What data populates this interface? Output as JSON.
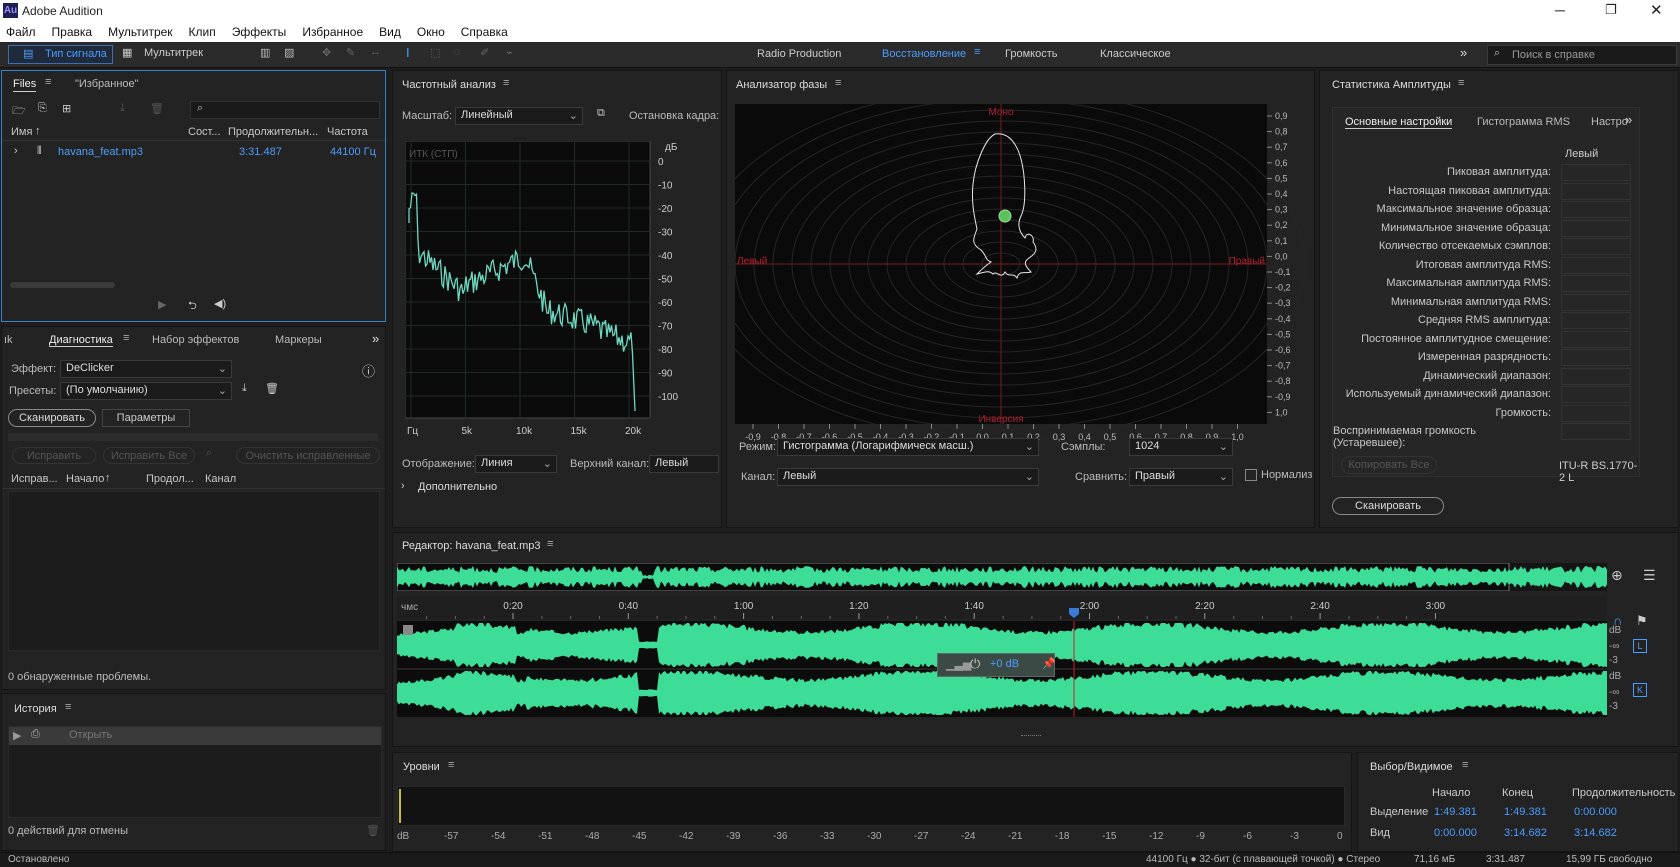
{
  "app": {
    "title": "Adobe Audition",
    "logo": "Au"
  },
  "menu": [
    "Файл",
    "Правка",
    "Мультитрек",
    "Клип",
    "Эффекты",
    "Избранное",
    "Вид",
    "Окно",
    "Справка"
  ],
  "toolbar": {
    "waveform_tab": "Тип сигнала",
    "multitrack_tab": "Мультитрек",
    "workspaces": [
      "Radio Production",
      "Восстановление",
      "Громкость",
      "Классическое"
    ],
    "active_workspace": "Восстановление",
    "search_placeholder": "Поиск в справке"
  },
  "files": {
    "tab_files": "Files",
    "tab_favorites": "\"Избранное\"",
    "columns": [
      "Имя",
      "Сост...",
      "Продолжительн...",
      "Частота"
    ],
    "rows": [
      {
        "name": "havana_feat.mp3",
        "duration": "3:31.487",
        "rate": "44100 Гц"
      }
    ]
  },
  "diagnostics": {
    "tab_cut": "ık",
    "tabs": [
      "Диагностика",
      "Набор эффектов",
      "Маркеры"
    ],
    "effect_label": "Эффект:",
    "effect_value": "DeClicker",
    "preset_label": "Пресеты:",
    "preset_value": "(По умолчанию)",
    "scan_button": "Сканировать",
    "params_button": "Параметры",
    "fix_button": "Исправить",
    "fix_all_button": "Исправить Все",
    "clear_button": "Очистить исправленные",
    "columns": [
      "Исправ...",
      "Начало",
      "Продол...",
      "Канал"
    ],
    "status": "0 обнаруженные проблемы."
  },
  "history": {
    "title": "История",
    "items": [
      "Открыть"
    ],
    "status": "0 действий для отмены"
  },
  "freq": {
    "title": "Частотный анализ",
    "scale_label": "Масштаб:",
    "scale_value": "Линейный",
    "freeze_label": "Остановка кадра:",
    "overlay": "ИТК (СТП)",
    "db_label": "дБ",
    "y_ticks": [
      "0",
      "-10",
      "-20",
      "-30",
      "-40",
      "-50",
      "-60",
      "-70",
      "-80",
      "-90",
      "-100"
    ],
    "x_ticks": [
      "Гц",
      "5k",
      "10k",
      "15k",
      "20k"
    ],
    "display_label": "Отображение:",
    "display_value": "Линия",
    "top_channel_label": "Верхний канал:",
    "top_channel_value": "Левый",
    "advanced": "Дополнительно"
  },
  "phase": {
    "title": "Анализатор фазы",
    "labels": {
      "top": "Моно",
      "bottom": "Инверсия",
      "left": "Левый",
      "right": "Правый"
    },
    "x_ticks": [
      "-0,9",
      "-0,8",
      "-0,7",
      "-0,6",
      "-0,5",
      "-0,4",
      "-0,3",
      "-0,2",
      "-0,1",
      "0,0",
      "0,1",
      "0,2",
      "0,3",
      "0,4",
      "0,5",
      "0,6",
      "0,7",
      "0,8",
      "0,9",
      "1,0"
    ],
    "y_ticks": [
      "0,9",
      "0,8",
      "0,7",
      "0,6",
      "0,5",
      "0,4",
      "0,3",
      "0,2",
      "0,1",
      "0,0",
      "-0,1",
      "-0,2",
      "-0,3",
      "-0,4",
      "-0,5",
      "-0,6",
      "-0,7",
      "-0,8",
      "-0,9",
      "1,0"
    ],
    "mode_label": "Режим:",
    "mode_value": "Гистограмма (Логарифмическ масш.)",
    "samples_label": "Сэмплы:",
    "samples_value": "1024",
    "channel_label": "Канал:",
    "channel_value": "Левый",
    "compare_label": "Сравнить:",
    "compare_value": "Правый",
    "normalize_label": "Нормализ"
  },
  "amplitude": {
    "title": "Статистика Амплитуды",
    "tabs": [
      "Основные настройки",
      "Гистограмма RMS",
      "Настро"
    ],
    "column": "Левый",
    "rows": [
      "Пиковая амплитуда:",
      "Настоящая пиковая амплитуда:",
      "Максимальное значение образца:",
      "Минимальное значение образца:",
      "Количество отсекаемых сэмплов:",
      "Итоговая амплитуда RMS:",
      "Максимальная амплитуда RMS:",
      "Минимальная амплитуда RMS:",
      "Средняя RMS амплитуда:",
      "Постоянное амплитудное смещение:",
      "Измеренная разрядность:",
      "Динамический диапазон:",
      "Используемый динамический диапазон:",
      "Громкость:",
      "Воспринимаемая громкость (Устаревшее):"
    ],
    "copy_button": "Копировать Все",
    "standard": "ITU-R BS.1770-2 L",
    "scan_button": "Сканировать"
  },
  "editor": {
    "title": "Редактор: havana_feat.mp3",
    "ruler_unit": "чмс",
    "ruler_ticks": [
      "0:20",
      "0:40",
      "1:00",
      "1:20",
      "1:40",
      "2:00",
      "2:20",
      "2:40",
      "3:00"
    ],
    "hud_gain": "+0 dB",
    "db_labels": [
      "dB",
      "-∞",
      "-3",
      "dB",
      "-∞",
      "-3"
    ],
    "channel_left": "L",
    "channel_right": "K"
  },
  "levels": {
    "title": "Уровни",
    "ticks": [
      "dB",
      "-57",
      "-54",
      "-51",
      "-48",
      "-45",
      "-42",
      "-39",
      "-36",
      "-33",
      "-30",
      "-27",
      "-24",
      "-21",
      "-18",
      "-15",
      "-12",
      "-9",
      "-6",
      "-3",
      "0"
    ]
  },
  "selection": {
    "title": "Выбор/Видимое",
    "columns": [
      "Начало",
      "Конец",
      "Продолжительность"
    ],
    "sel_label": "Выделение",
    "sel": [
      "1:49.381",
      "1:49.381",
      "0:00.000"
    ],
    "view_label": "Вид",
    "view": [
      "0:00.000",
      "3:14.682",
      "3:14.682"
    ]
  },
  "status": {
    "left": "Остановлено",
    "format": "44100 Гц ● 32-бит (с плавающей точкой) ● Стерео",
    "size": "71,16 мБ",
    "duration": "3:31.487",
    "free": "15,99 ГБ свободно"
  },
  "colors": {
    "wave": "#3ddc97",
    "accent": "#4d9cff",
    "playhead": "#3a7bd5",
    "marker_red": "#c8202a"
  }
}
